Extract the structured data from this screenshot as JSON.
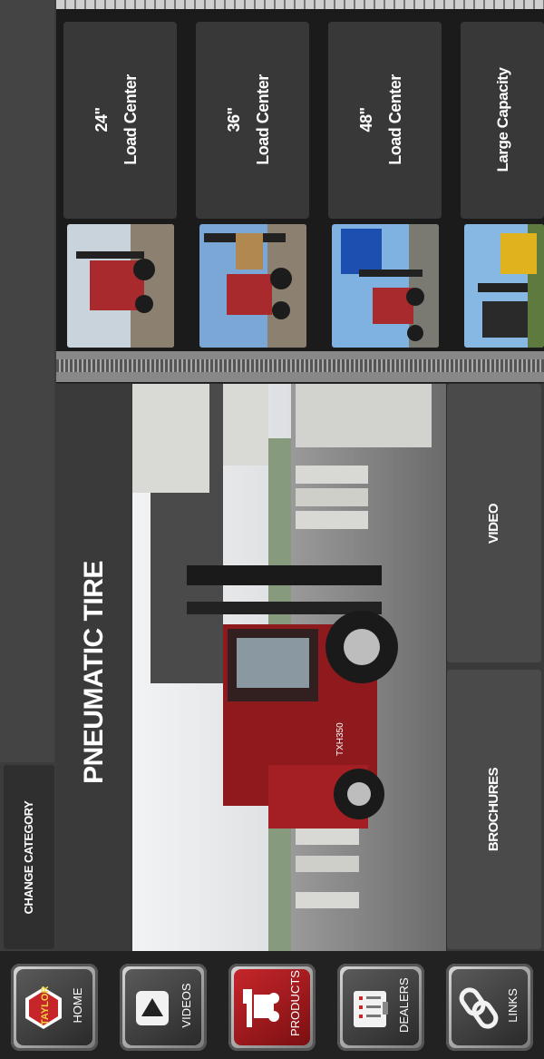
{
  "category_button": {
    "label": "CHANGE CATEGORY"
  },
  "product": {
    "title": "PNEUMATIC TIRE"
  },
  "actions": {
    "video_label": "VIDEO",
    "brochures_label": "BROCHURES"
  },
  "carousel": {
    "cards": [
      {
        "line1": "24\"",
        "line2": "Load Center"
      },
      {
        "line1": "36\"",
        "line2": "Load Center"
      },
      {
        "line1": "48\"",
        "line2": "Load Center"
      },
      {
        "line1": "Large Capacity",
        "line2": ""
      }
    ]
  },
  "nav": {
    "items": [
      {
        "label": "HOME",
        "icon": "taylor-logo-icon"
      },
      {
        "label": "VIDEOS",
        "icon": "play-icon"
      },
      {
        "label": "PRODUCTS",
        "icon": "forklift-icon"
      },
      {
        "label": "DEALERS",
        "icon": "clipboard-icon"
      },
      {
        "label": "LINKS",
        "icon": "chain-link-icon"
      }
    ]
  },
  "hero_image": {
    "truck_model": "TXH350"
  },
  "brand": {
    "logo_text": "TAYLOR",
    "accent": "#c6262a"
  }
}
